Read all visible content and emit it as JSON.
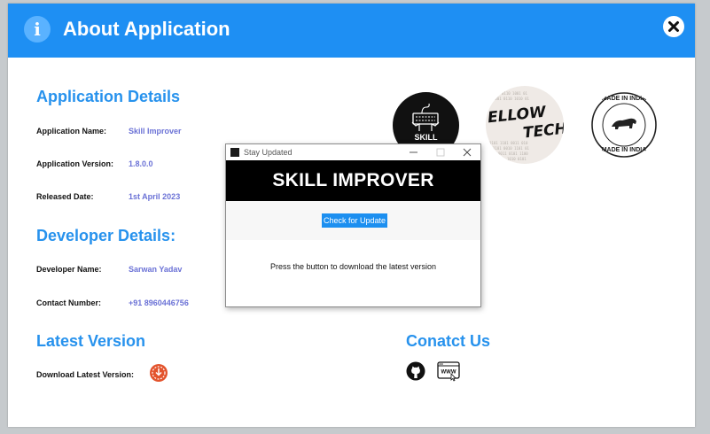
{
  "window": {
    "title": "About Application",
    "info_icon": "info-icon",
    "close_icon": "close-icon"
  },
  "app_details": {
    "heading": "Application Details",
    "name_label": "Application Name:",
    "name_value": "Skill Improver",
    "version_label": "Application Version:",
    "version_value": "1.8.0.0",
    "date_label": "Released Date:",
    "date_value": "1st April 2023"
  },
  "dev_details": {
    "heading": "Developer Details:",
    "name_label": "Developer Name:",
    "name_value": "Sarwan Yadav",
    "contact_label": "Contact Number:",
    "contact_value": "+91 8960446756"
  },
  "latest": {
    "heading": "Latest Version",
    "download_label": "Download Latest Version:",
    "download_icon": "download-icon"
  },
  "contact": {
    "heading": "Conatct Us",
    "github_icon": "github-icon",
    "website_icon": "www-icon"
  },
  "logos": {
    "skill_text": "SKILL",
    "fellow_line1": "ELLOW",
    "fellow_line2": "TECH",
    "india_top": "MADE IN INDIA",
    "india_bottom": "MADE IN INDIA"
  },
  "dialog": {
    "title": "Stay Updated",
    "banner": "SKILL IMPROVER",
    "button_label": "Check for Update",
    "message": "Press the button to download the latest version"
  },
  "colors": {
    "header": "#1e8ff3",
    "section_heading": "#2792ed",
    "value_text": "#6b72d6",
    "button": "#1c8ff0"
  }
}
